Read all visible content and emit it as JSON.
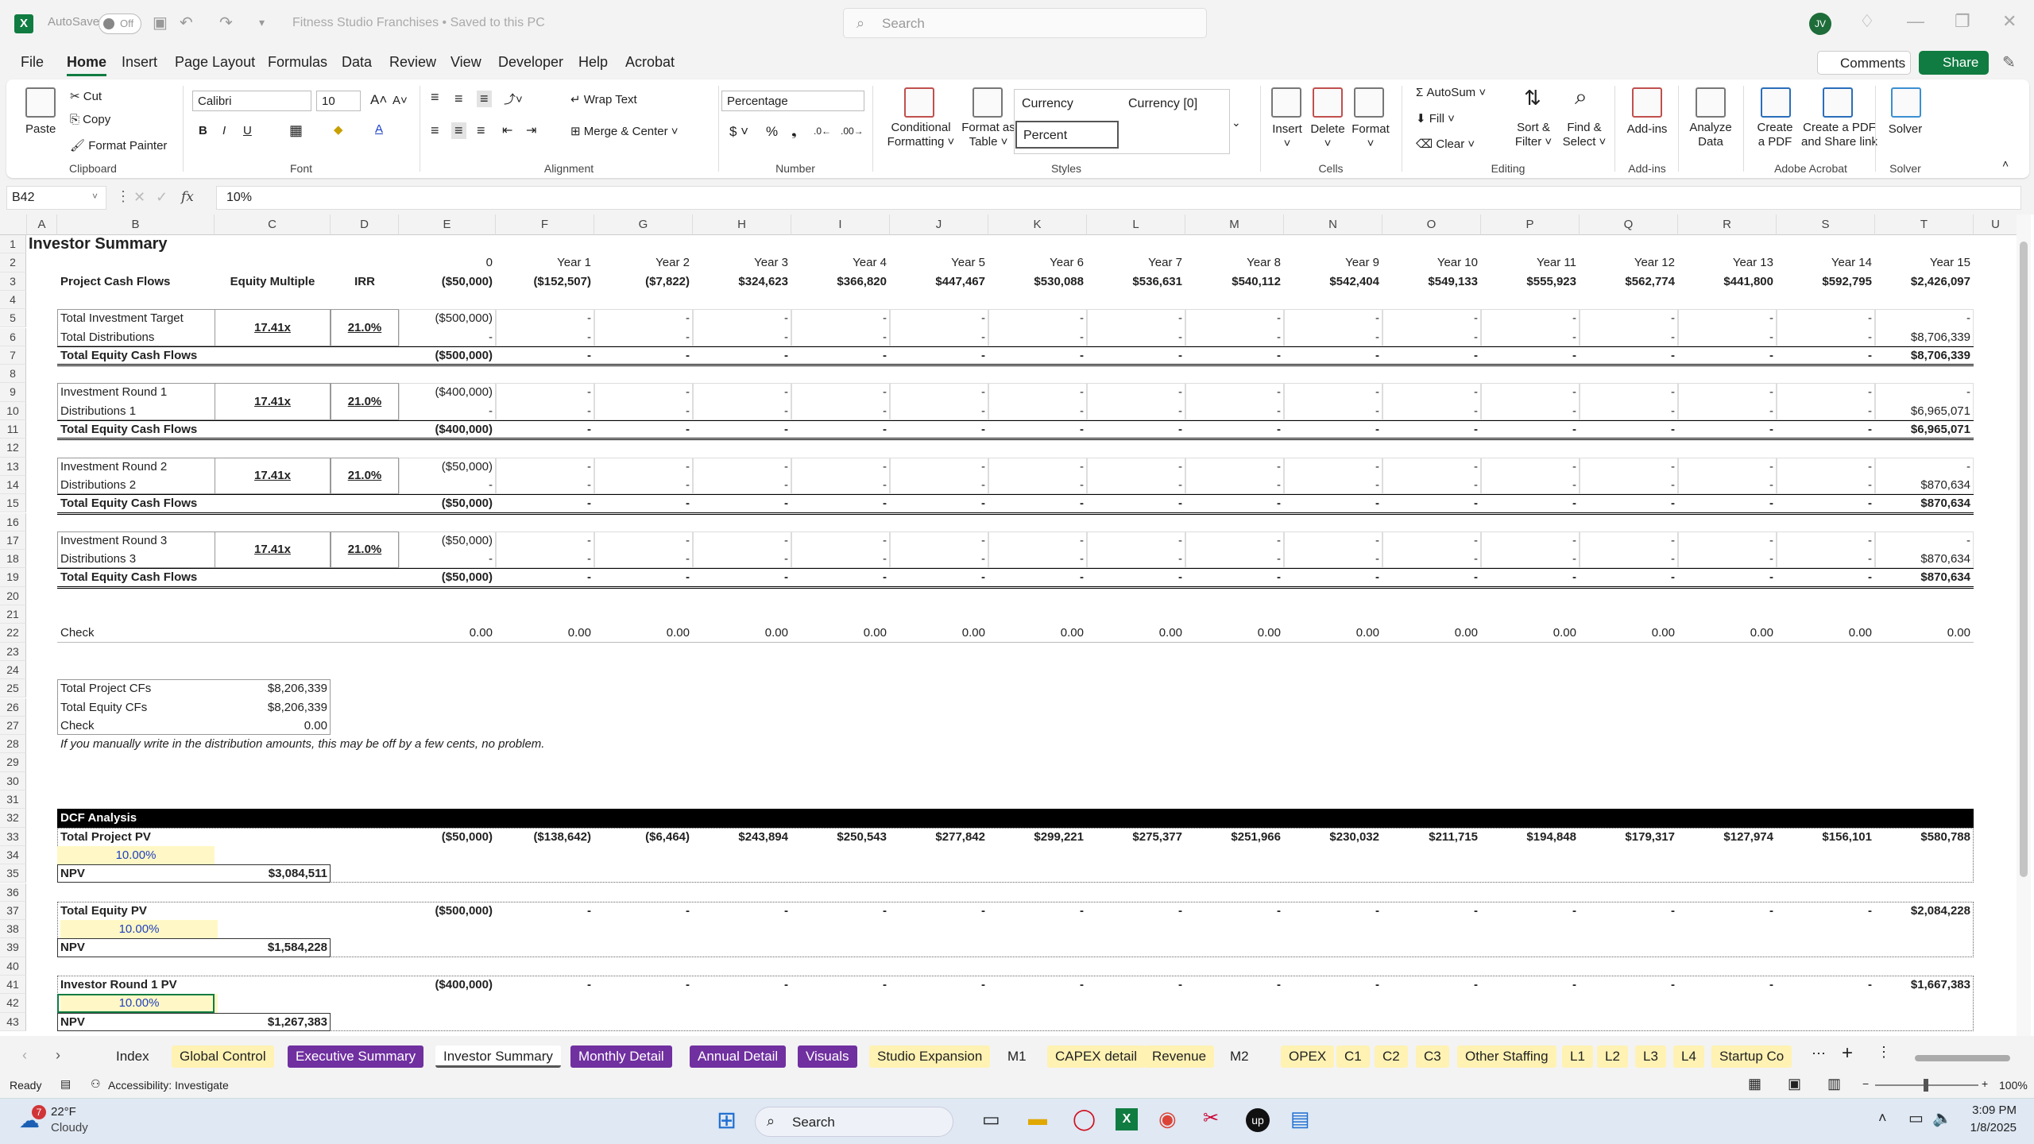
{
  "titlebar": {
    "autosave": "AutoSave",
    "toggle": "Off",
    "doc_title": "Fitness Studio Franchises • Saved to this PC",
    "search_placeholder": "Search",
    "avatar": "JV"
  },
  "menu": {
    "tabs": [
      "File",
      "Home",
      "Insert",
      "Page Layout",
      "Formulas",
      "Data",
      "Review",
      "View",
      "Developer",
      "Help",
      "Acrobat"
    ],
    "comments": "Comments",
    "share": "Share"
  },
  "ribbon": {
    "clipboard": {
      "paste": "Paste",
      "cut": "Cut",
      "copy": "Copy",
      "format_painter": "Format Painter",
      "label": "Clipboard"
    },
    "font": {
      "name": "Calibri",
      "size": "10",
      "label": "Font"
    },
    "alignment": {
      "wrap": "Wrap Text",
      "merge": "Merge & Center",
      "label": "Alignment"
    },
    "number": {
      "format": "Percentage",
      "label": "Number"
    },
    "styles": {
      "cond": [
        "Conditional",
        "Formatting"
      ],
      "table": [
        "Format as",
        "Table"
      ],
      "currency": "Currency",
      "currency0": "Currency [0]",
      "percent": "Percent",
      "label": "Styles"
    },
    "cells": {
      "insert": "Insert",
      "delete": "Delete",
      "format": "Format",
      "label": "Cells"
    },
    "editing": {
      "autosum": "AutoSum",
      "fill": "Fill",
      "clear": "Clear",
      "sort": [
        "Sort &",
        "Filter"
      ],
      "find": [
        "Find &",
        "Select"
      ],
      "label": "Editing"
    },
    "addins": {
      "addins": "Add-ins",
      "label": "Add-ins"
    },
    "analyze": [
      "Analyze",
      "Data"
    ],
    "acrobat": {
      "create": [
        "Create",
        "a PDF"
      ],
      "share": [
        "Create a PDF",
        "and Share link"
      ],
      "label": "Adobe Acrobat"
    },
    "solver": {
      "solver": "Solver",
      "label": "Solver"
    }
  },
  "formula_bar": {
    "name": "B42",
    "fx": "fx",
    "value": "10%"
  },
  "columns": [
    "A",
    "B",
    "C",
    "D",
    "E",
    "F",
    "G",
    "H",
    "I",
    "J",
    "K",
    "L",
    "M",
    "N",
    "O",
    "P",
    "Q",
    "R",
    "S",
    "T",
    "U"
  ],
  "sheet": {
    "title": "Investor Summary",
    "years": [
      "0",
      "Year 1",
      "Year 2",
      "Year 3",
      "Year 4",
      "Year 5",
      "Year 6",
      "Year 7",
      "Year 8",
      "Year 9",
      "Year 10",
      "Year 11",
      "Year 12",
      "Year 13",
      "Year 14",
      "Year 15"
    ],
    "hdr3": {
      "b": "Project Cash Flows",
      "c": "Equity Multiple",
      "d": "IRR",
      "vals": [
        "($50,000)",
        "($152,507)",
        "($7,822)",
        "$324,623",
        "$366,820",
        "$447,467",
        "$530,088",
        "$536,631",
        "$540,112",
        "$542,404",
        "$549,133",
        "$555,923",
        "$562,774",
        "$441,800",
        "$592,795",
        "$2,426,097"
      ]
    },
    "blocks": [
      {
        "inv": "Total Investment Target",
        "dist": "Total Distributions",
        "total": "Total Equity Cash Flows",
        "mult": "17.41x",
        "irr": "21.0%",
        "inv0": "($500,000)",
        "dist0": "-",
        "tot0": "($500,000)",
        "dist15": "$8,706,339",
        "tot15": "$8,706,339"
      },
      {
        "inv": "Investment Round 1",
        "dist": "Distributions 1",
        "total": "Total Equity Cash Flows",
        "mult": "17.41x",
        "irr": "21.0%",
        "inv0": "($400,000)",
        "dist0": "-",
        "tot0": "($400,000)",
        "dist15": "$6,965,071",
        "tot15": "$6,965,071"
      },
      {
        "inv": "Investment Round 2",
        "dist": "Distributions 2",
        "total": "Total Equity Cash Flows",
        "mult": "17.41x",
        "irr": "21.0%",
        "inv0": "($50,000)",
        "dist0": "-",
        "tot0": "($50,000)",
        "dist15": "$870,634",
        "tot15": "$870,634"
      },
      {
        "inv": "Investment Round 3",
        "dist": "Distributions 3",
        "total": "Total Equity Cash Flows",
        "mult": "17.41x",
        "irr": "21.0%",
        "inv0": "($50,000)",
        "dist0": "-",
        "tot0": "($50,000)",
        "dist15": "$870,634",
        "tot15": "$870,634"
      }
    ],
    "dash": "-",
    "check": {
      "label": "Check",
      "value": "0.00"
    },
    "summary": {
      "rows": [
        [
          "Total Project CFs",
          "$8,206,339"
        ],
        [
          "Total Equity CFs",
          "$8,206,339"
        ],
        [
          "Check",
          "0.00"
        ]
      ],
      "note": "If you manually write in the distribution amounts, this may be off by a few cents, no problem."
    },
    "dcf": {
      "title": "DCF Analysis",
      "project": {
        "label": "Total Project PV",
        "vals": [
          "($50,000)",
          "($138,642)",
          "($6,464)",
          "$243,894",
          "$250,543",
          "$277,842",
          "$299,221",
          "$275,377",
          "$251,966",
          "$230,032",
          "$211,715",
          "$194,848",
          "$179,317",
          "$127,974",
          "$156,101",
          "$580,788"
        ],
        "rate": "10.00%",
        "npv_label": "NPV",
        "npv": "$3,084,511"
      },
      "equity": {
        "label": "Total Equity PV",
        "v0": "($500,000)",
        "v15": "$2,084,228",
        "rate": "10.00%",
        "npv_label": "NPV",
        "npv": "$1,584,228"
      },
      "round1": {
        "label": "Investor Round 1 PV",
        "v0": "($400,000)",
        "v15": "$1,667,383",
        "rate": "10.00%",
        "npv_label": "NPV",
        "npv": "$1,267,383"
      }
    }
  },
  "sheet_tabs": [
    {
      "name": "Index",
      "bg": "#f3f3f3",
      "fg": "#222"
    },
    {
      "name": "Global Control",
      "bg": "#fff2b3",
      "fg": "#222"
    },
    {
      "name": "Executive Summary",
      "bg": "#7030a0",
      "fg": "#ffffff"
    },
    {
      "name": "Investor Summary",
      "bg": "#ffffff",
      "fg": "#222",
      "active": true
    },
    {
      "name": "Monthly Detail",
      "bg": "#7030a0",
      "fg": "#ffffff"
    },
    {
      "name": "Annual Detail",
      "bg": "#7030a0",
      "fg": "#ffffff"
    },
    {
      "name": "Visuals",
      "bg": "#7030a0",
      "fg": "#ffffff"
    },
    {
      "name": "Studio Expansion",
      "bg": "#fff2b3",
      "fg": "#222"
    },
    {
      "name": "M1",
      "bg": "#f3f3f3",
      "fg": "#222"
    },
    {
      "name": "CAPEX detail",
      "bg": "#fff2b3",
      "fg": "#222"
    },
    {
      "name": "Revenue",
      "bg": "#fff2b3",
      "fg": "#222"
    },
    {
      "name": "M2",
      "bg": "#f3f3f3",
      "fg": "#222"
    },
    {
      "name": "OPEX",
      "bg": "#fff2b3",
      "fg": "#222"
    },
    {
      "name": "C1",
      "bg": "#fff2b3",
      "fg": "#222"
    },
    {
      "name": "C2",
      "bg": "#fff2b3",
      "fg": "#222"
    },
    {
      "name": "C3",
      "bg": "#fff2b3",
      "fg": "#222"
    },
    {
      "name": "Other Staffing",
      "bg": "#fff2b3",
      "fg": "#222"
    },
    {
      "name": "L1",
      "bg": "#fff2b3",
      "fg": "#222"
    },
    {
      "name": "L2",
      "bg": "#fff2b3",
      "fg": "#222"
    },
    {
      "name": "L3",
      "bg": "#fff2b3",
      "fg": "#222"
    },
    {
      "name": "L4",
      "bg": "#fff2b3",
      "fg": "#222"
    },
    {
      "name": "Startup Co",
      "bg": "#fff2b3",
      "fg": "#222"
    }
  ],
  "status": {
    "ready": "Ready",
    "accessibility": "Accessibility: Investigate",
    "zoom": "100%"
  },
  "taskbar": {
    "temp": "22°F",
    "weather": "Cloudy",
    "badge": "7",
    "search": "Search",
    "time": "3:09 PM",
    "date": "1/8/2025"
  }
}
